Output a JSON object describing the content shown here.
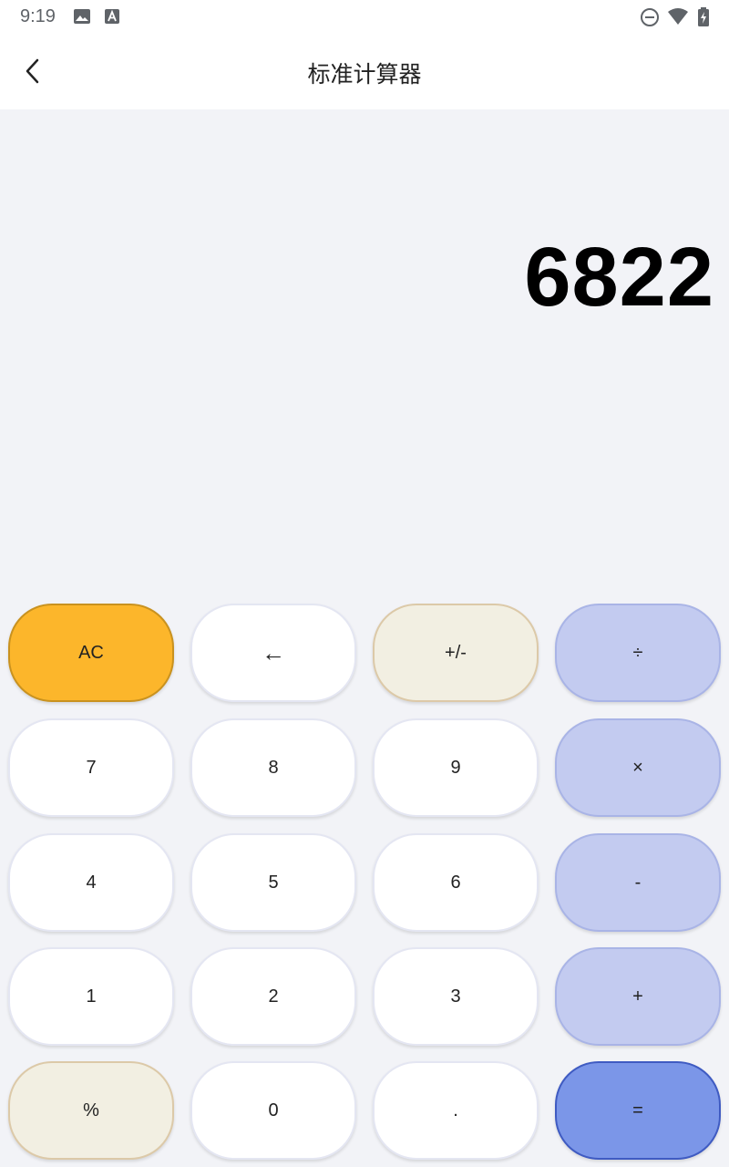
{
  "status_bar": {
    "time": "9:19",
    "left_icons": [
      "image-icon",
      "text-a-icon"
    ],
    "right_icons": [
      "do-not-disturb-icon",
      "wifi-icon",
      "battery-charging-icon"
    ]
  },
  "header": {
    "title": "标准计算器",
    "back_icon": "chevron-left-icon"
  },
  "display": {
    "value": "6822"
  },
  "keypad": {
    "ac": "AC",
    "backspace": "←",
    "sign": "+/-",
    "divide": "÷",
    "seven": "7",
    "eight": "8",
    "nine": "9",
    "multiply": "×",
    "four": "4",
    "five": "5",
    "six": "6",
    "minus": "-",
    "one": "1",
    "two": "2",
    "three": "3",
    "plus": "+",
    "percent": "%",
    "zero": "0",
    "dot": ".",
    "equals": "="
  },
  "colors": {
    "ac": "#fcb62b",
    "function": "#f2efe2",
    "operator": "#c3cbf0",
    "equals": "#7b96e8",
    "digit": "#ffffff",
    "background": "#f2f3f7"
  }
}
